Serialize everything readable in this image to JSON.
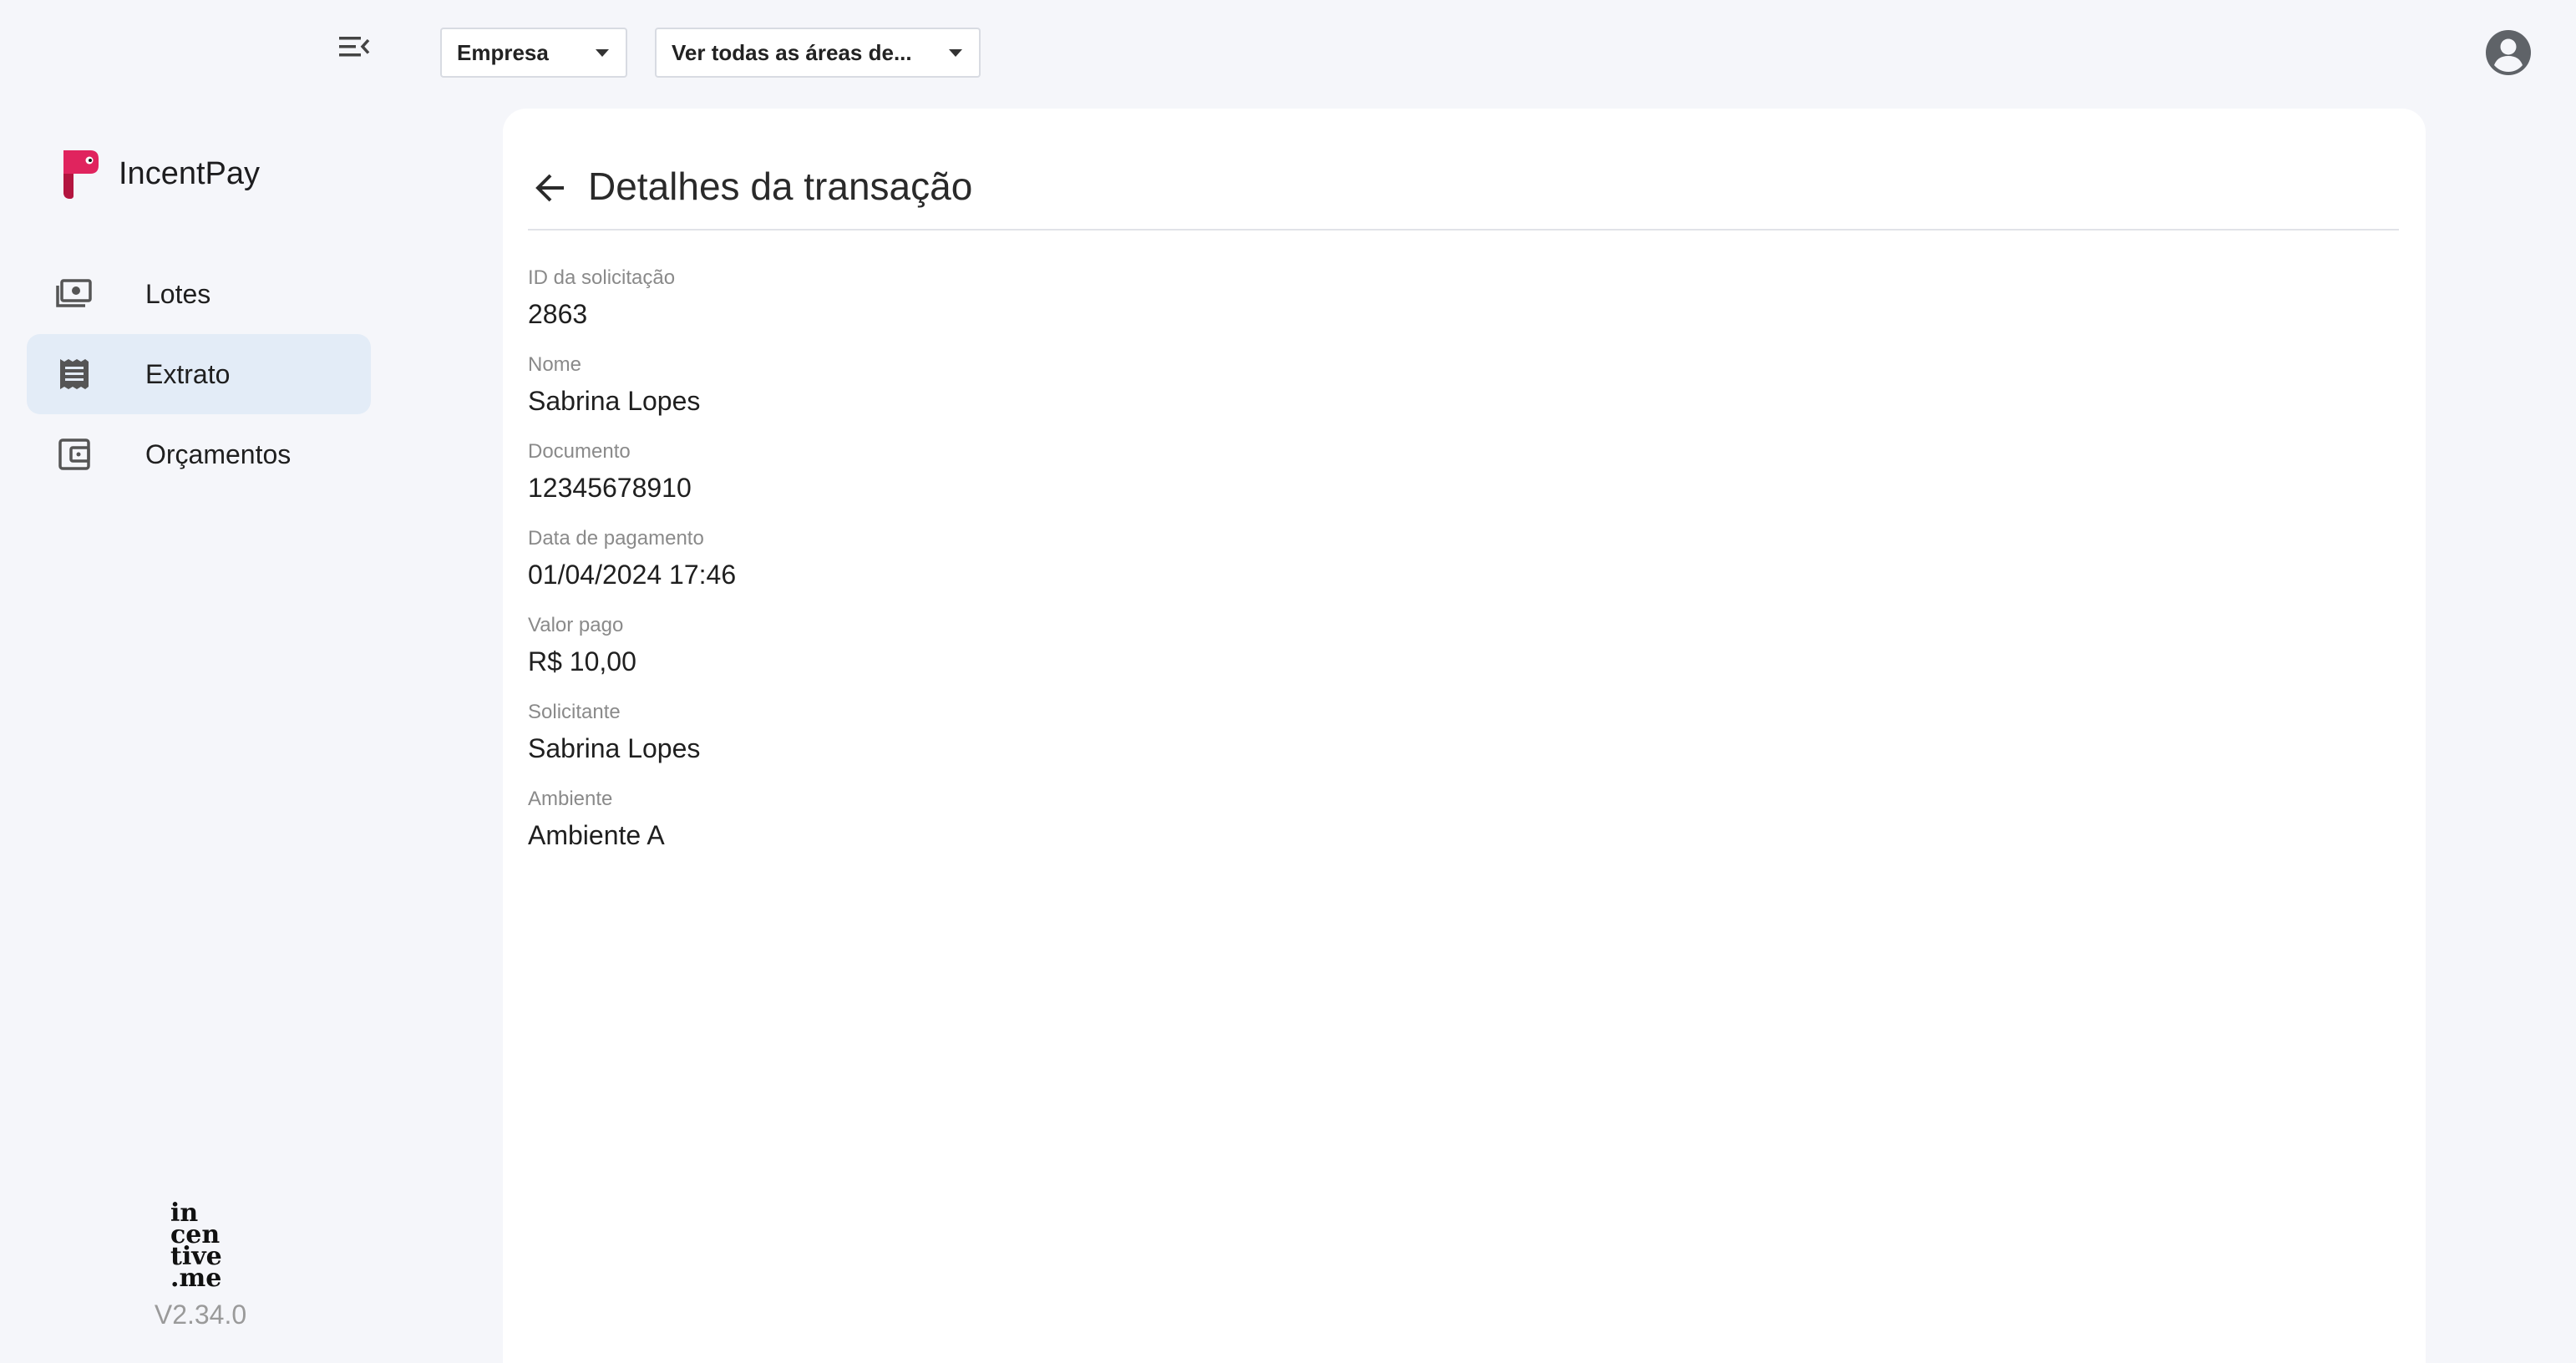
{
  "sidebar": {
    "brand_name": "IncentPay",
    "nav": [
      {
        "label": "Lotes",
        "icon": "money-icon",
        "active": false
      },
      {
        "label": "Extrato",
        "icon": "receipt-icon",
        "active": true
      },
      {
        "label": "Orçamentos",
        "icon": "wallet-icon",
        "active": false
      }
    ],
    "footer_logo": "in cen tive .me",
    "version": "V2.34.0"
  },
  "topbar": {
    "company_select": "Empresa",
    "areas_select": "Ver todas as áreas de..."
  },
  "page": {
    "title": "Detalhes da transação",
    "fields": [
      {
        "label": "ID da solicitação",
        "value": "2863"
      },
      {
        "label": "Nome",
        "value": "Sabrina Lopes"
      },
      {
        "label": "Documento",
        "value": "12345678910"
      },
      {
        "label": "Data de pagamento",
        "value": "01/04/2024 17:46"
      },
      {
        "label": "Valor pago",
        "value": "R$ 10,00"
      },
      {
        "label": "Solicitante",
        "value": "Sabrina Lopes"
      },
      {
        "label": "Ambiente",
        "value": "Ambiente A"
      }
    ]
  },
  "colors": {
    "background": "#f5f6fa",
    "active_nav": "#e3ecf7",
    "brand": "#e0245e"
  }
}
